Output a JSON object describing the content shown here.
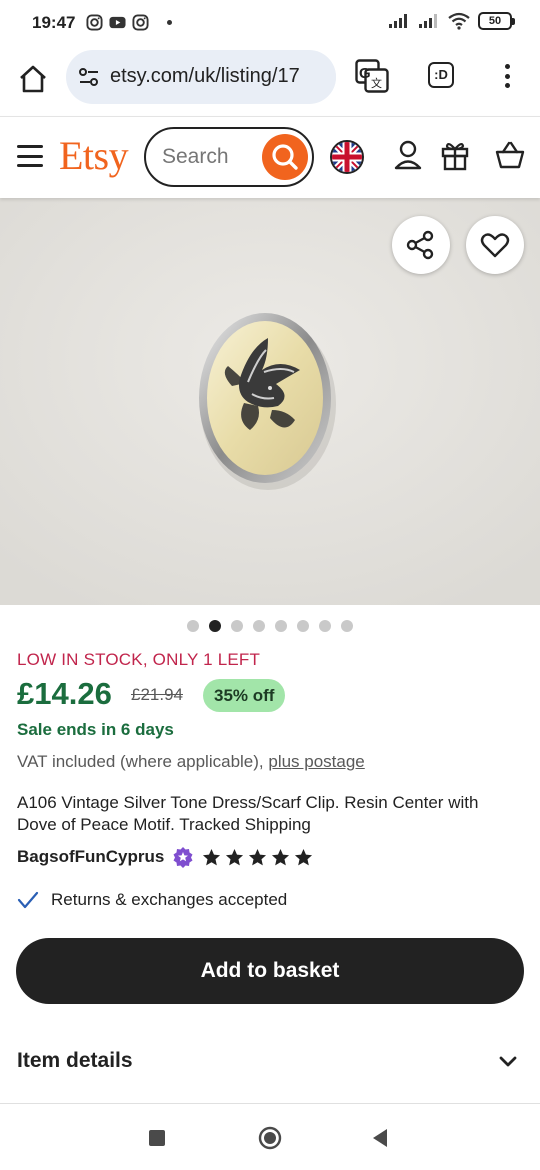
{
  "status_bar": {
    "time": "19:47",
    "battery": "50",
    "icons_left": [
      "instagram-icon",
      "youtube-icon",
      "instagram-icon"
    ],
    "icons_right": [
      "signal-icon",
      "signal-icon",
      "wifi-icon",
      "battery-icon"
    ]
  },
  "browser": {
    "url": "etsy.com/uk/listing/17",
    "ext_label": ":D"
  },
  "header": {
    "logo": "Etsy",
    "search_placeholder": "Search"
  },
  "gallery": {
    "image_count": 8,
    "active_index": 1
  },
  "product": {
    "stock_notice": "LOW IN STOCK, ONLY 1 LEFT",
    "price": "£14.26",
    "old_price": "£21.94",
    "discount": "35% off",
    "sale_ends": "Sale ends in 6 days",
    "vat_text": "VAT included (where applicable), ",
    "vat_link": "plus postage",
    "title": "A106 Vintage Silver Tone Dress/Scarf Clip. Resin Center with Dove of Peace Motif. Tracked Shipping",
    "shop_name": "BagsofFunCyprus",
    "rating_stars": 5,
    "returns": "Returns & exchanges accepted",
    "add_to_basket": "Add to basket",
    "item_details": "Item details"
  },
  "colors": {
    "etsy_orange": "#f1641e",
    "price_green": "#1b6d3e",
    "stock_red": "#c1254c",
    "discount_bg": "#a2e5a9",
    "button_dark": "#222222"
  }
}
